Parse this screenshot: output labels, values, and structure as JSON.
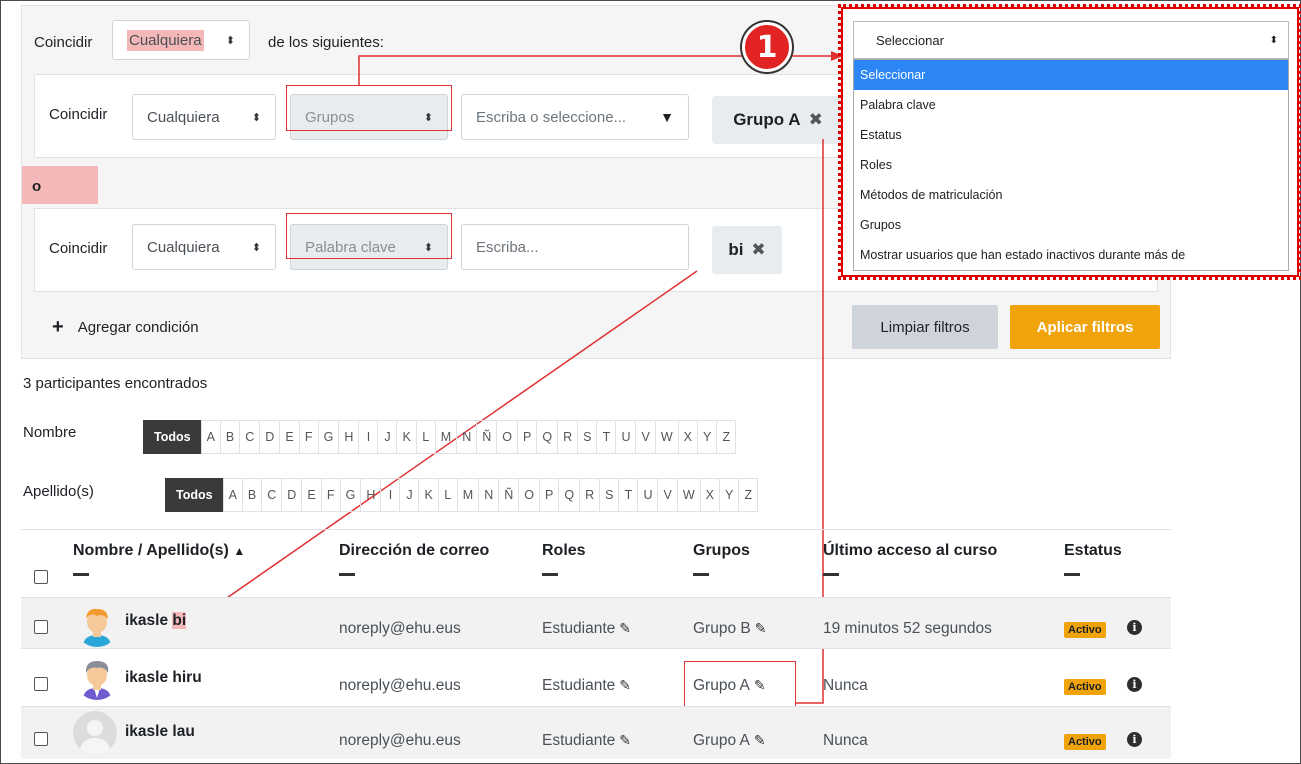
{
  "filter": {
    "match_label": "Coincidir",
    "match_value": "Cualquiera",
    "of_following": "de los siguientes:",
    "or_label": "o",
    "add_condition": "Agregar condición",
    "clear_filters": "Limpiar filtros",
    "apply_filters": "Aplicar filtros",
    "row1": {
      "match_label": "Coincidir",
      "match_value": "Cualquiera",
      "type_value": "Grupos",
      "input_placeholder": "Escriba o seleccione...",
      "tag": "Grupo A"
    },
    "row2": {
      "match_label": "Coincidir",
      "match_value": "Cualquiera",
      "type_value": "Palabra clave",
      "input_placeholder": "Escriba...",
      "tag": "bi"
    }
  },
  "dropdown": {
    "selected": "Seleccionar",
    "options": [
      "Seleccionar",
      "Palabra clave",
      "Estatus",
      "Roles",
      "Métodos de matriculación",
      "Grupos",
      "Mostrar usuarios que han estado inactivos durante más de"
    ]
  },
  "step_marker": "1",
  "results_count": "3 participantes encontrados",
  "initials": {
    "first_label": "Nombre",
    "last_label": "Apellido(s)",
    "all_label": "Todos",
    "letters": [
      "A",
      "B",
      "C",
      "D",
      "E",
      "F",
      "G",
      "H",
      "I",
      "J",
      "K",
      "L",
      "M",
      "N",
      "Ñ",
      "O",
      "P",
      "Q",
      "R",
      "S",
      "T",
      "U",
      "V",
      "W",
      "X",
      "Y",
      "Z"
    ]
  },
  "table": {
    "headers": [
      "Nombre / Apellido(s)",
      "Dirección de correo",
      "Roles",
      "Grupos",
      "Último acceso al curso",
      "Estatus"
    ],
    "rows": [
      {
        "name_prefix": "ikasle ",
        "name_highlight": "bi",
        "email": "noreply@ehu.eus",
        "role": "Estudiante",
        "group": "Grupo B",
        "last_access": "19 minutos 52 segundos",
        "status": "Activo"
      },
      {
        "name_prefix": "ikasle hiru",
        "name_highlight": "",
        "email": "noreply@ehu.eus",
        "role": "Estudiante",
        "group": "Grupo A",
        "last_access": "Nunca",
        "status": "Activo"
      },
      {
        "name_prefix": "ikasle lau",
        "name_highlight": "",
        "email": "noreply@ehu.eus",
        "role": "Estudiante",
        "group": "Grupo A",
        "last_access": "Nunca",
        "status": "Activo"
      }
    ]
  },
  "colors": {
    "accent": "#f0a30a",
    "annotation_red": "#e03030",
    "selected_option": "#2c86f5"
  }
}
